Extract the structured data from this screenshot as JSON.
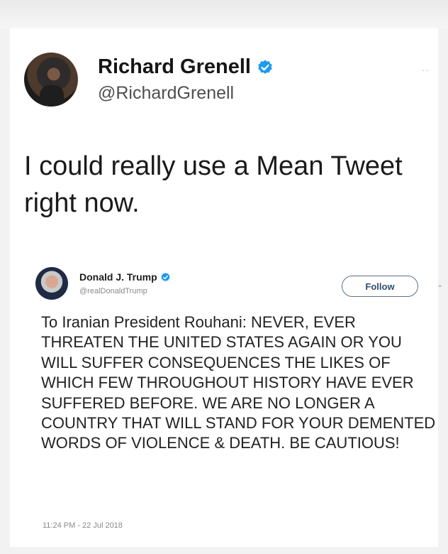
{
  "tweet": {
    "author_name": "Richard Grenell",
    "author_handle": "@RichardGrenell",
    "more_menu": "··",
    "text": "I could really use a Mean Tweet right now."
  },
  "quoted_tweet": {
    "author_name": "Donald J. Trump",
    "author_handle": "@realDonaldTrump",
    "follow_label": "Follow",
    "text": "To Iranian President Rouhani: NEVER, EVER THREATEN THE UNITED STATES AGAIN OR YOU WILL SUFFER CONSEQUENCES THE LIKES OF WHICH FEW THROUGHOUT HISTORY HAVE EVER SUFFERED BEFORE. WE ARE NO LONGER A COUNTRY THAT WILL STAND FOR YOUR DEMENTED WORDS OF VIOLENCE & DEATH. BE CAUTIOUS!",
    "timestamp": "11:24 PM - 22 Jul 2018"
  },
  "colors": {
    "verified_blue": "#1d9bf0",
    "follow_border": "#5b6f86"
  },
  "icons": {
    "verified": "verified-badge-icon",
    "chevron": "chevron-down-icon",
    "more": "more-options-icon"
  }
}
